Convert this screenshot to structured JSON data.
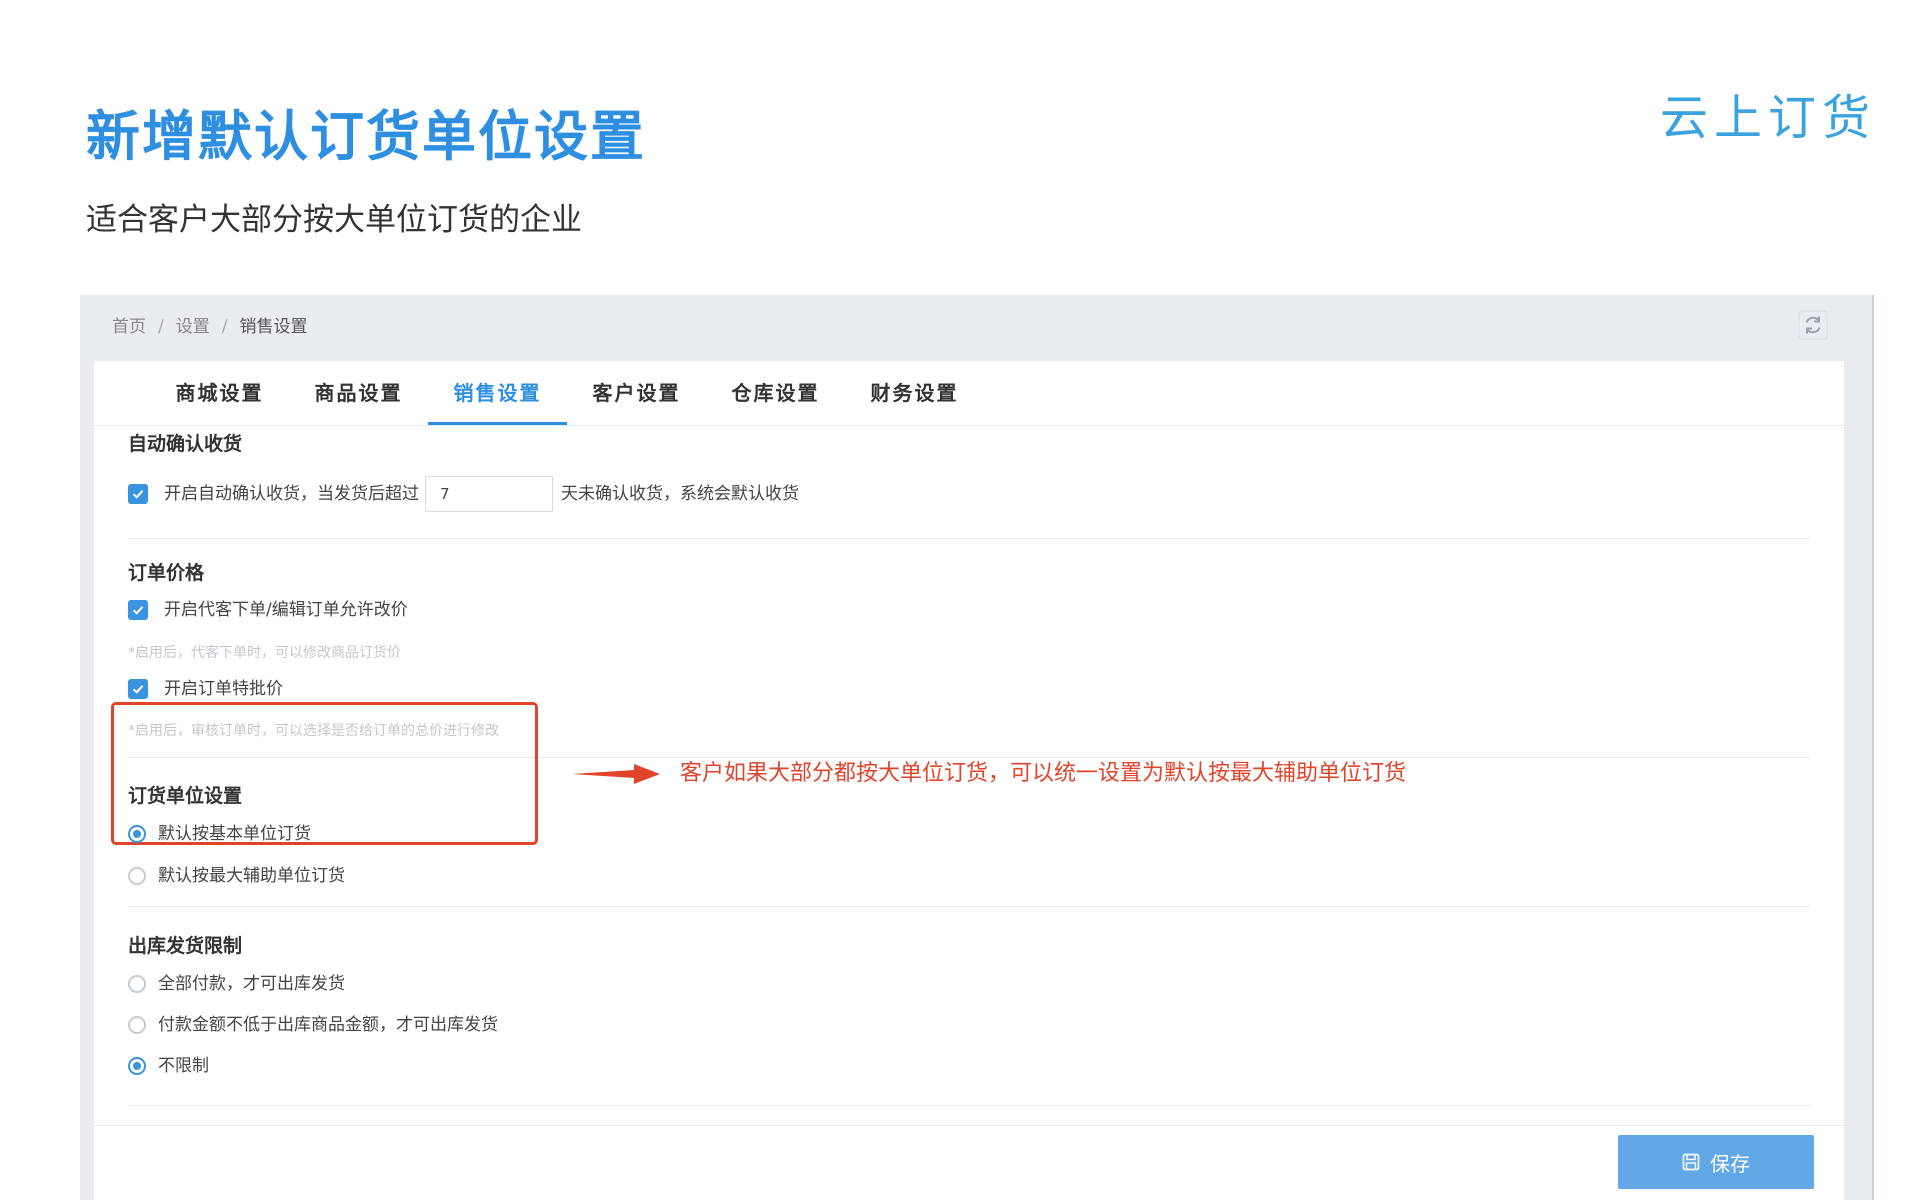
{
  "hero": {
    "title": "新增默认订货单位设置",
    "subtitle": "适合客户大部分按大单位订货的企业",
    "brand": "云上订货"
  },
  "breadcrumb": {
    "home": "首页",
    "sep": "/",
    "settings": "设置",
    "current": "销售设置"
  },
  "tabs": [
    "商城设置",
    "商品设置",
    "销售设置",
    "客户设置",
    "仓库设置",
    "财务设置"
  ],
  "active_tab": "销售设置",
  "auto_confirm": {
    "title": "自动确认收货",
    "label_before": "开启自动确认收货，当发货后超过",
    "days_value": "7",
    "label_after": "天未确认收货，系统会默认收货",
    "checked": true
  },
  "order_price": {
    "title": "订单价格",
    "option1_label": "开启代客下单/编辑订单允许改价",
    "option1_hint": "*启用后，代客下单时，可以修改商品订货价",
    "option2_label": "开启订单特批价",
    "option2_hint": "*启用后，审核订单时，可以选择是否给订单的总价进行修改"
  },
  "order_unit": {
    "title": "订货单位设置",
    "options": [
      "默认按基本单位订货",
      "默认按最大辅助单位订货"
    ],
    "selected_index": 0
  },
  "annotation": {
    "text": "客户如果大部分都按大单位订货，可以统一设置为默认按最大辅助单位订货",
    "color": "#e0452c"
  },
  "shipping_limit": {
    "title": "出库发货限制",
    "options": [
      "全部付款，才可出库发货",
      "付款金额不低于出库商品金额，才可出库发货",
      "不限制"
    ],
    "selected_index": 2
  },
  "save_button": {
    "label": "保存",
    "icon": "save-icon"
  },
  "colors": {
    "accent": "#2e8fe0",
    "checkbox": "#3a93de",
    "annotation": "#e0452c",
    "save_button": "#62a8e6"
  }
}
